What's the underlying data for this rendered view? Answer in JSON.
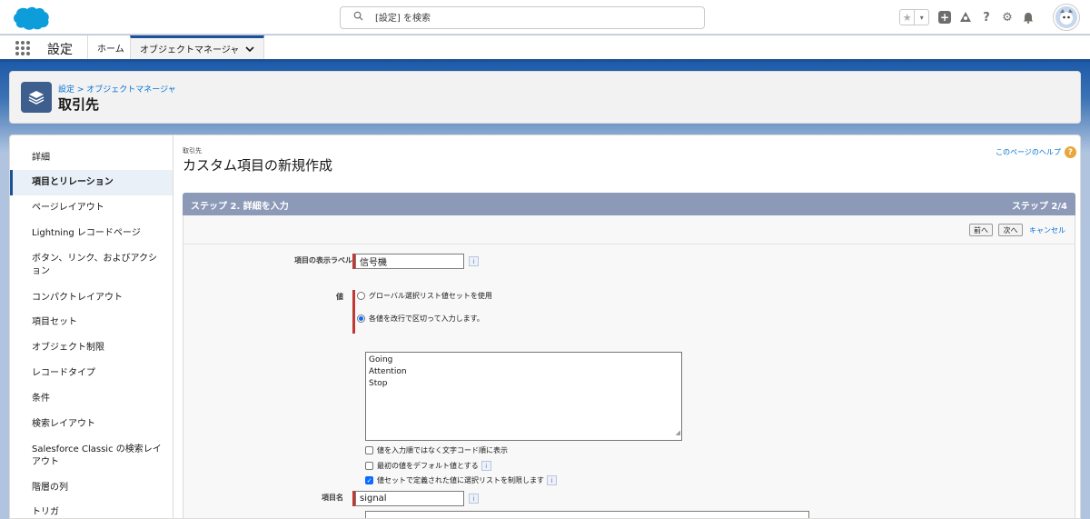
{
  "header": {
    "search_placeholder": "[設定] を検索",
    "fav_star": "★",
    "fav_caret": "▾",
    "icons": [
      "plus-icon",
      "trailhead-icon",
      "help-icon",
      "setup-gear-icon",
      "notification-bell-icon"
    ],
    "help_glyph": "?",
    "gear_glyph": "⚙"
  },
  "context_bar": {
    "app_name": "設定",
    "tabs": [
      {
        "label": "ホーム"
      },
      {
        "label": "オブジェクトマネージャ",
        "chevron": "⌄"
      }
    ]
  },
  "page_header": {
    "breadcrumb": "設定 > オブジェクトマネージャ",
    "title": "取引先"
  },
  "sidebar": {
    "items": [
      {
        "label": "詳細"
      },
      {
        "label": "項目とリレーション"
      },
      {
        "label": "ページレイアウト"
      },
      {
        "label": "Lightning レコードページ"
      },
      {
        "label": "ボタン、リンク、およびアクション"
      },
      {
        "label": "コンパクトレイアウト"
      },
      {
        "label": "項目セット"
      },
      {
        "label": "オブジェクト制限"
      },
      {
        "label": "レコードタイプ"
      },
      {
        "label": "条件"
      },
      {
        "label": "検索レイアウト"
      },
      {
        "label": "Salesforce Classic の検索レイアウト"
      },
      {
        "label": "階層の列"
      },
      {
        "label": "トリガ"
      }
    ],
    "active_index": 1
  },
  "content": {
    "caption": "取引先",
    "title": "カスタム項目の新規作成",
    "help_link": "このページのヘルプ",
    "help_glyph": "?",
    "step_title": "ステップ 2. 詳細を入力",
    "step_count": "ステップ 2/4",
    "buttons": {
      "prev": "前へ",
      "next": "次へ",
      "cancel": "キャンセル"
    },
    "form": {
      "label_field": {
        "label": "項目の表示ラベル",
        "value": "信号機"
      },
      "values_label": "値",
      "radio_global": "グローバル選択リスト値セットを使用",
      "radio_enter": "各値を改行で区切って入力します。",
      "values_lines": [
        "Going",
        "Attention",
        "Stop"
      ],
      "check_sort": "値を入力順ではなく文字コード順に表示",
      "check_default": "最初の値をデフォルト値とする",
      "check_restrict": "値セットで定義された値に選択リストを制限します",
      "api_name": {
        "label": "項目名",
        "value": "signal"
      },
      "info_glyph": "i",
      "check_glyph": "✓"
    }
  }
}
